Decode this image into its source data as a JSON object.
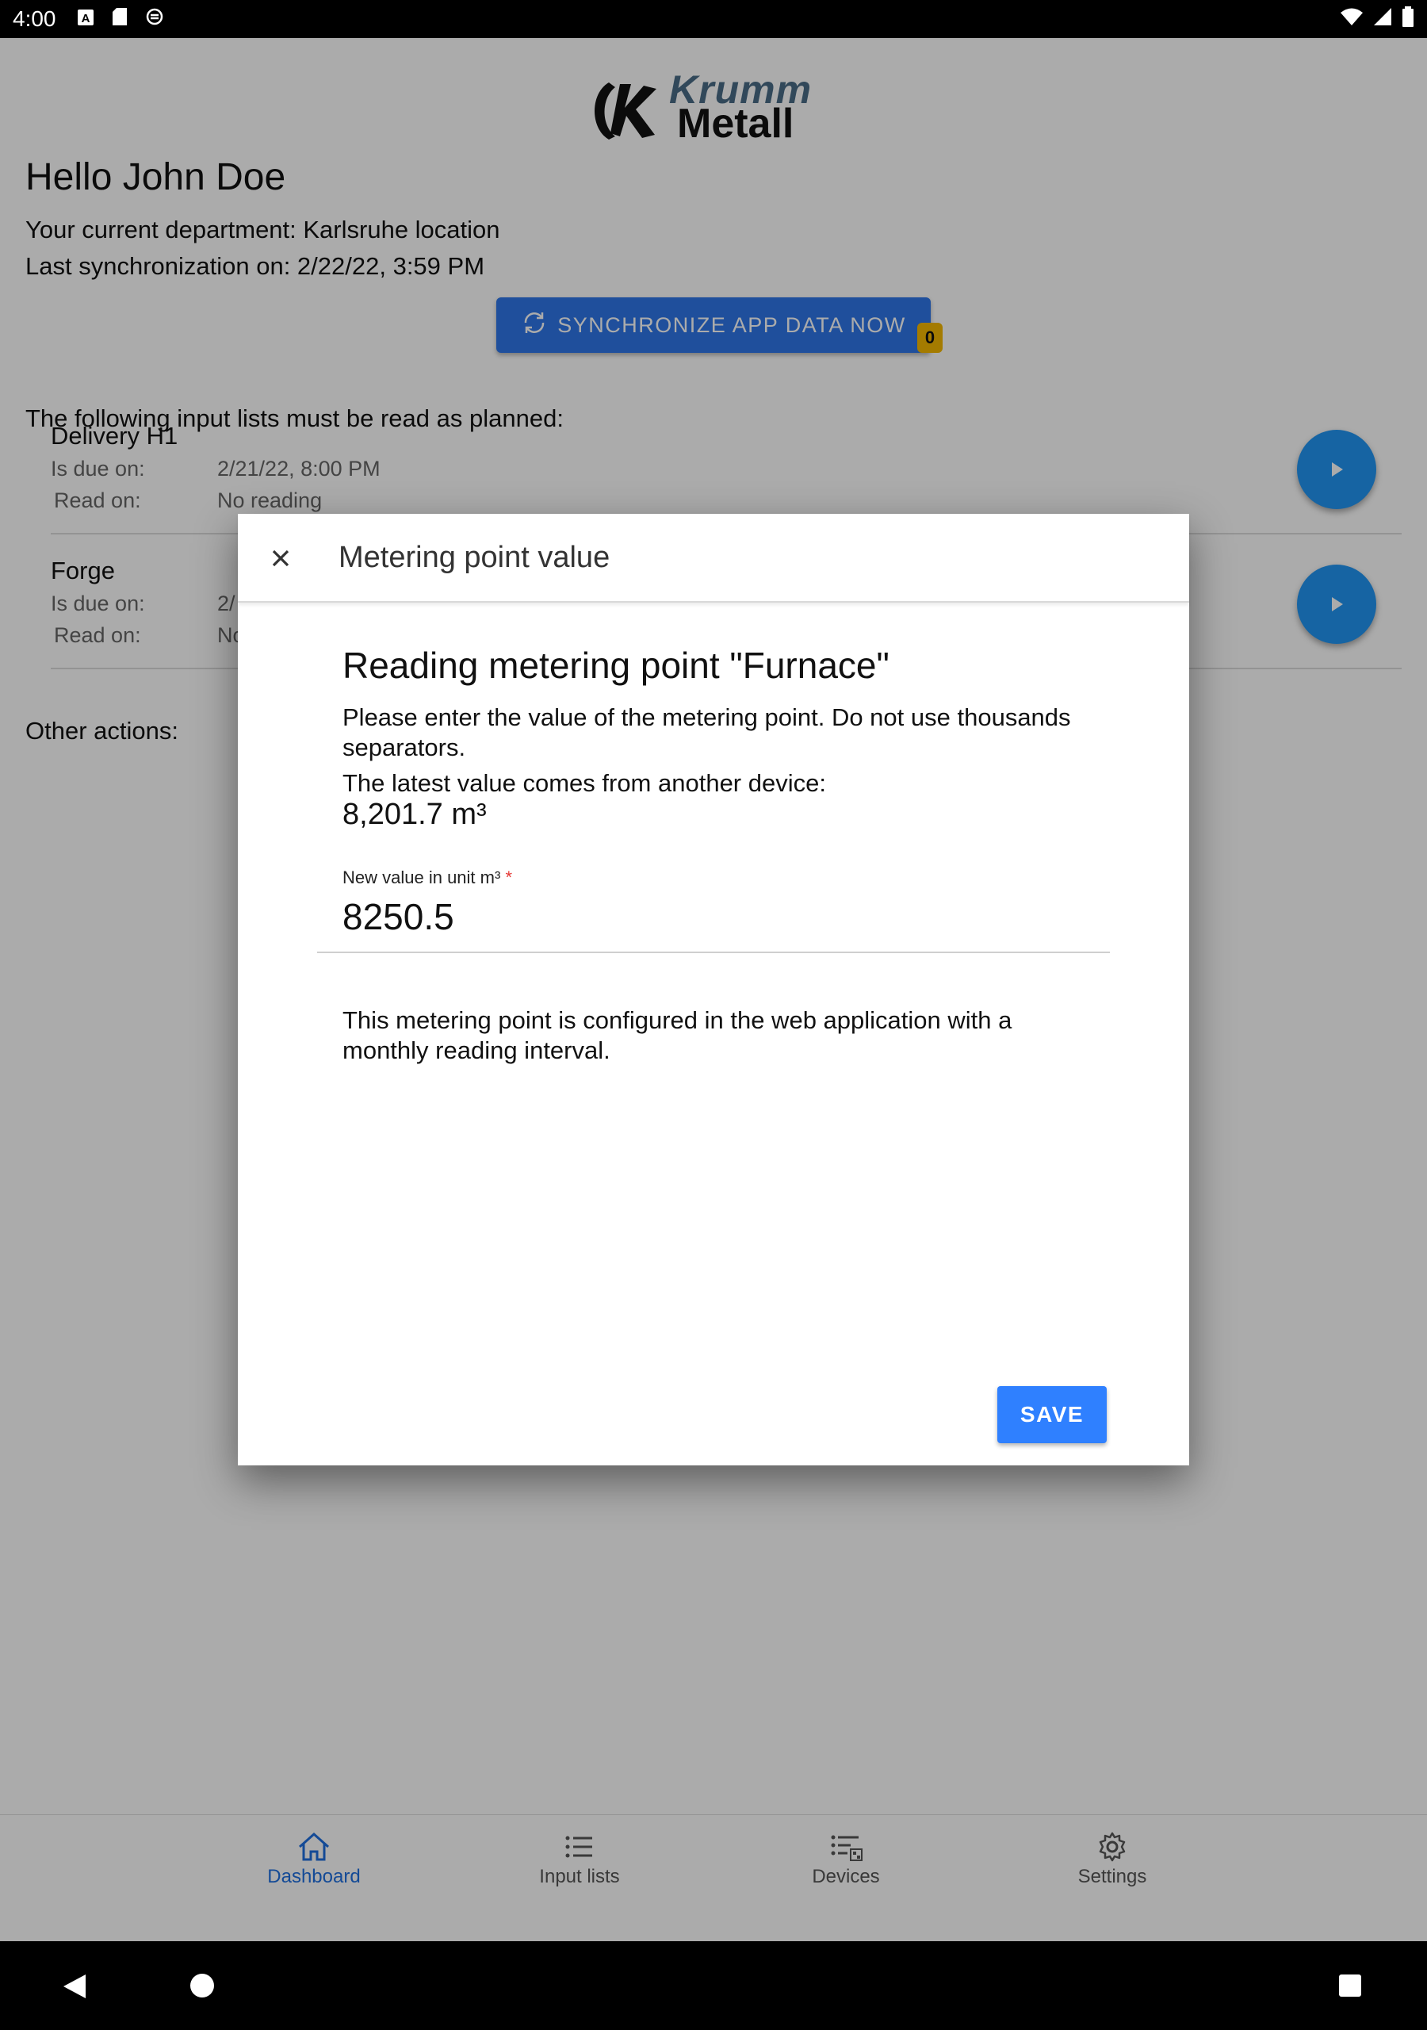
{
  "status_bar": {
    "time": "4:00",
    "left_icons": [
      "a-icon",
      "sd-card-icon",
      "sync-circle-icon"
    ],
    "right_icons": [
      "wifi-icon",
      "signal-icon",
      "battery-icon"
    ]
  },
  "brand": {
    "line1": "Krumm",
    "line2": "Metall",
    "accent_color": "#4a6c86"
  },
  "dashboard": {
    "greeting": "Hello John Doe",
    "department": "Your current department: Karlsruhe location",
    "last_sync": "Last synchronization on: 2/22/22, 3:59 PM",
    "sync_button_label": "SYNCHRONIZE APP DATA NOW",
    "sync_badge": "0",
    "lists_intro": "The following input lists must be read as planned:",
    "input_lists": [
      {
        "name": "Delivery H1",
        "due_label": "Is due on:",
        "due_value": "2/21/22, 8:00 PM",
        "read_label": "Read on:",
        "read_value": "No reading"
      },
      {
        "name": "Forge",
        "due_label": "Is due on:",
        "due_value": "2/",
        "read_label": "Read on:",
        "read_value": "No"
      }
    ],
    "other_actions": "Other actions:"
  },
  "bottom_nav": {
    "items": [
      {
        "label": "Dashboard",
        "icon": "home-icon",
        "active": true
      },
      {
        "label": "Input lists",
        "icon": "list-icon",
        "active": false
      },
      {
        "label": "Devices",
        "icon": "devices-icon",
        "active": false
      },
      {
        "label": "Settings",
        "icon": "gear-icon",
        "active": false
      }
    ]
  },
  "dialog": {
    "title": "Metering point value",
    "heading": "Reading metering point \"Furnace\"",
    "description": "Please enter the value of the metering point. Do not use thousands separators.",
    "latest_label": "The latest value comes from another device:",
    "latest_value": "8,201.7 m³",
    "field_label": "New value in unit m³",
    "field_required_mark": "*",
    "field_value": "8250.5",
    "config_note": "This metering point is configured in the web application with a monthly reading interval.",
    "save_label": "SAVE"
  },
  "colors": {
    "primary": "#2f77e9",
    "fab": "#2196f3",
    "badge": "#f5b800",
    "nav_active": "#1e6fe0"
  }
}
